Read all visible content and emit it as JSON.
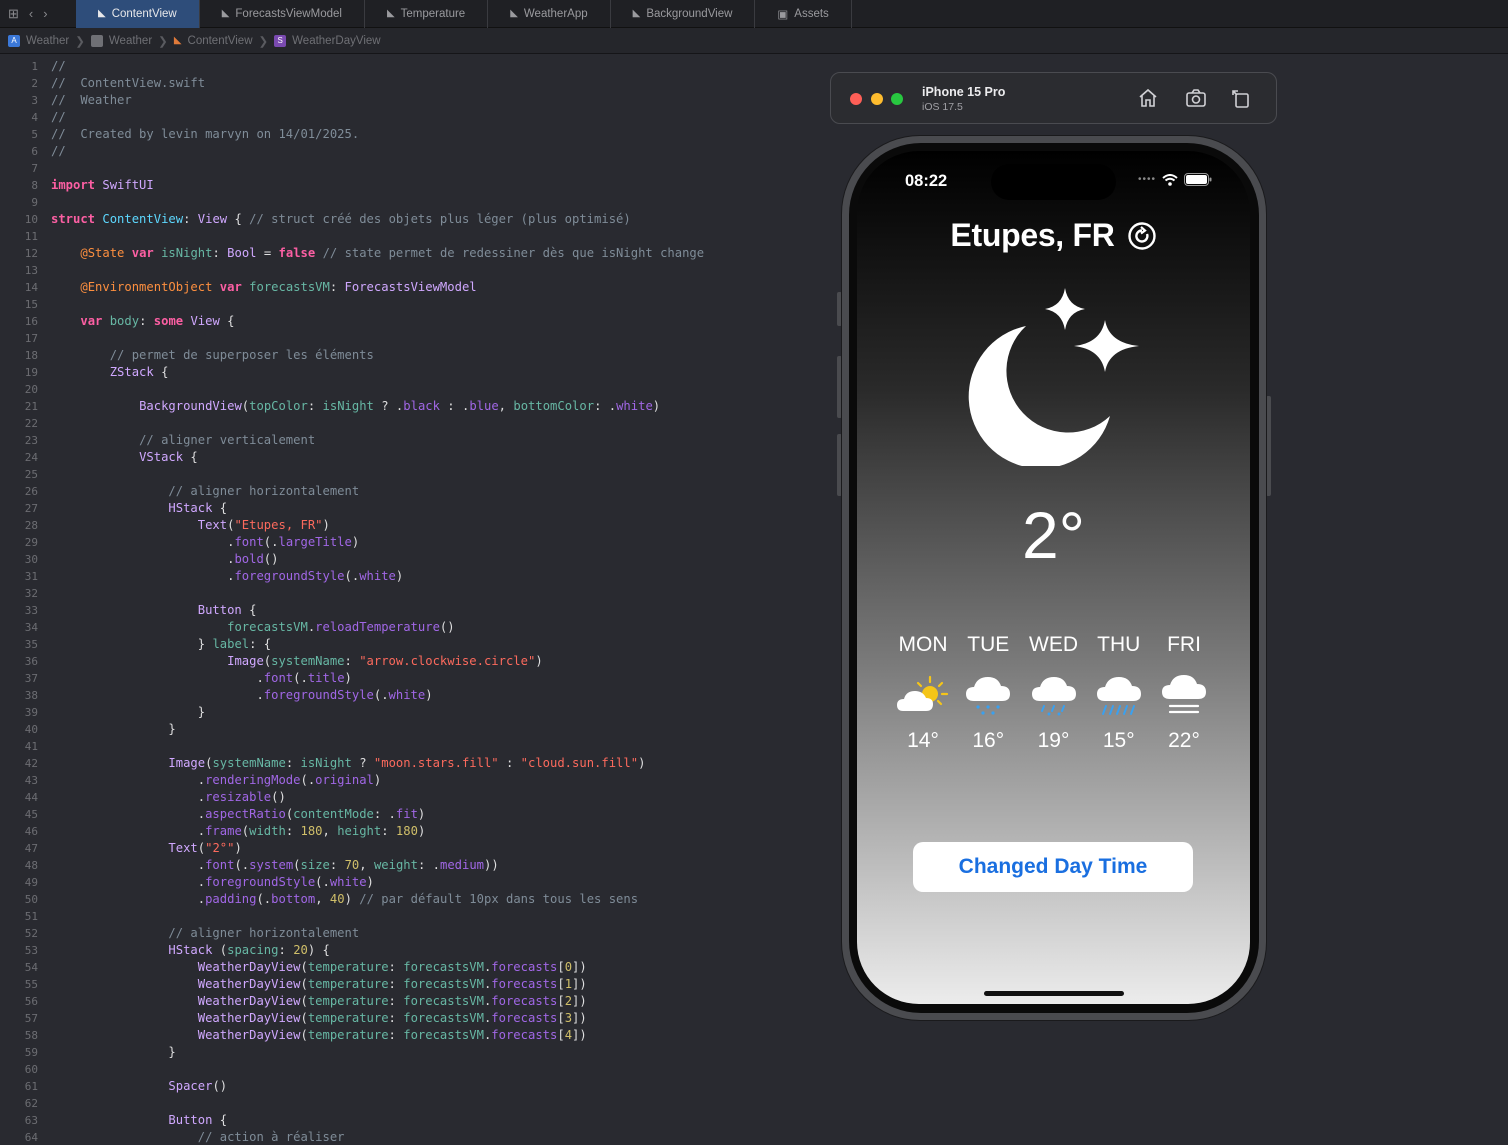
{
  "tabs": [
    {
      "label": "ContentView",
      "active": true
    },
    {
      "label": "ForecastsViewModel",
      "active": false
    },
    {
      "label": "Temperature",
      "active": false
    },
    {
      "label": "WeatherApp",
      "active": false
    },
    {
      "label": "BackgroundView",
      "active": false
    },
    {
      "label": "Assets",
      "active": false
    }
  ],
  "breadcrumb": [
    "Weather",
    "Weather",
    "ContentView",
    "WeatherDayView"
  ],
  "code_lines": [
    {
      "n": "1",
      "t": "//"
    },
    {
      "n": "2",
      "t": "//  ContentView.swift"
    },
    {
      "n": "3",
      "t": "//  Weather"
    },
    {
      "n": "4",
      "t": "//"
    },
    {
      "n": "5",
      "t": "//  Created by levin marvyn on 14/01/2025."
    },
    {
      "n": "6",
      "t": "//"
    },
    {
      "n": "7",
      "t": ""
    },
    {
      "n": "8",
      "t": "import SwiftUI"
    },
    {
      "n": "9",
      "t": ""
    },
    {
      "n": "10",
      "t": "struct ContentView: View { // struct créé des objets plus léger (plus optimisé)"
    },
    {
      "n": "11",
      "t": ""
    },
    {
      "n": "12",
      "t": "    @State var isNight: Bool = false // state permet de redessiner dès que isNight change"
    },
    {
      "n": "13",
      "t": ""
    },
    {
      "n": "14",
      "t": "    @EnvironmentObject var forecastsVM: ForecastsViewModel"
    },
    {
      "n": "15",
      "t": ""
    },
    {
      "n": "16",
      "t": "    var body: some View {"
    },
    {
      "n": "17",
      "t": ""
    },
    {
      "n": "18",
      "t": "        // permet de superposer les éléments"
    },
    {
      "n": "19",
      "t": "        ZStack {"
    },
    {
      "n": "20",
      "t": ""
    },
    {
      "n": "21",
      "t": "            BackgroundView(topColor: isNight ? .black : .blue, bottomColor: .white)"
    },
    {
      "n": "22",
      "t": ""
    },
    {
      "n": "23",
      "t": "            // aligner verticalement"
    },
    {
      "n": "24",
      "t": "            VStack {"
    },
    {
      "n": "25",
      "t": ""
    },
    {
      "n": "26",
      "t": "                // aligner horizontalement"
    },
    {
      "n": "27",
      "t": "                HStack {"
    },
    {
      "n": "28",
      "t": "                    Text(\"Etupes, FR\")"
    },
    {
      "n": "29",
      "t": "                        .font(.largeTitle)"
    },
    {
      "n": "30",
      "t": "                        .bold()"
    },
    {
      "n": "31",
      "t": "                        .foregroundStyle(.white)"
    },
    {
      "n": "32",
      "t": ""
    },
    {
      "n": "33",
      "t": "                    Button {"
    },
    {
      "n": "34",
      "t": "                        forecastsVM.reloadTemperature()"
    },
    {
      "n": "35",
      "t": "                    } label: {"
    },
    {
      "n": "36",
      "t": "                        Image(systemName: \"arrow.clockwise.circle\")"
    },
    {
      "n": "37",
      "t": "                            .font(.title)"
    },
    {
      "n": "38",
      "t": "                            .foregroundStyle(.white)"
    },
    {
      "n": "39",
      "t": "                    }"
    },
    {
      "n": "40",
      "t": "                }"
    },
    {
      "n": "41",
      "t": ""
    },
    {
      "n": "42",
      "t": "                Image(systemName: isNight ? \"moon.stars.fill\" : \"cloud.sun.fill\")"
    },
    {
      "n": "43",
      "t": "                    .renderingMode(.original)"
    },
    {
      "n": "44",
      "t": "                    .resizable()"
    },
    {
      "n": "45",
      "t": "                    .aspectRatio(contentMode: .fit)"
    },
    {
      "n": "46",
      "t": "                    .frame(width: 180, height: 180)"
    },
    {
      "n": "47",
      "t": "                Text(\"2°\")"
    },
    {
      "n": "48",
      "t": "                    .font(.system(size: 70, weight: .medium))"
    },
    {
      "n": "49",
      "t": "                    .foregroundStyle(.white)"
    },
    {
      "n": "50",
      "t": "                    .padding(.bottom, 40) // par défault 10px dans tous les sens"
    },
    {
      "n": "51",
      "t": ""
    },
    {
      "n": "52",
      "t": "                // aligner horizontalement"
    },
    {
      "n": "53",
      "t": "                HStack (spacing: 20) {"
    },
    {
      "n": "54",
      "t": "                    WeatherDayView(temperature: forecastsVM.forecasts[0])"
    },
    {
      "n": "55",
      "t": "                    WeatherDayView(temperature: forecastsVM.forecasts[1])"
    },
    {
      "n": "56",
      "t": "                    WeatherDayView(temperature: forecastsVM.forecasts[2])"
    },
    {
      "n": "57",
      "t": "                    WeatherDayView(temperature: forecastsVM.forecasts[3])"
    },
    {
      "n": "58",
      "t": "                    WeatherDayView(temperature: forecastsVM.forecasts[4])"
    },
    {
      "n": "59",
      "t": "                }"
    },
    {
      "n": "60",
      "t": ""
    },
    {
      "n": "61",
      "t": "                Spacer()"
    },
    {
      "n": "62",
      "t": ""
    },
    {
      "n": "63",
      "t": "                Button {"
    },
    {
      "n": "64",
      "t": "                    // action à réaliser"
    }
  ],
  "simulator": {
    "device": "iPhone 15 Pro",
    "os": "iOS 17.5"
  },
  "phone": {
    "time": "08:22",
    "city": "Etupes, FR",
    "temperature": "2°",
    "forecast": [
      {
        "day": "MON",
        "temp": "14°",
        "icon": "cloud-sun-icon"
      },
      {
        "day": "TUE",
        "temp": "16°",
        "icon": "cloud-snow-icon"
      },
      {
        "day": "WED",
        "temp": "19°",
        "icon": "cloud-sleet-icon"
      },
      {
        "day": "THU",
        "temp": "15°",
        "icon": "cloud-rain-icon"
      },
      {
        "day": "FRI",
        "temp": "22°",
        "icon": "cloud-fog-icon"
      }
    ],
    "button_label": "Changed Day Time"
  },
  "colors": {
    "accent_tab": "#2e4d7a",
    "button_text": "#1a6fe0",
    "sun": "#f5c518",
    "precip": "#3aa0ef"
  }
}
